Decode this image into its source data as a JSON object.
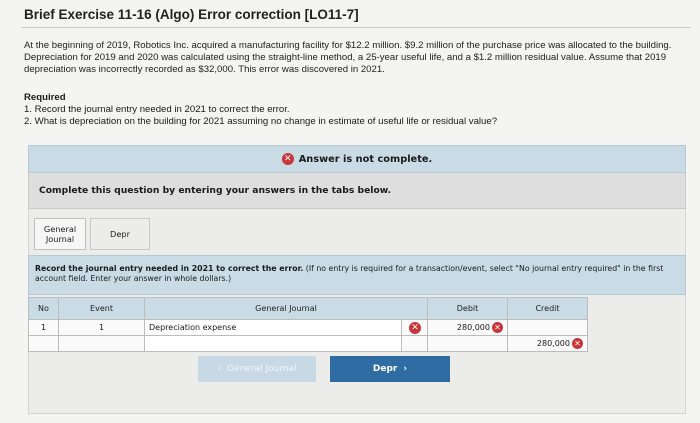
{
  "page": {
    "title": "Brief Exercise 11-16 (Algo) Error correction [LO11-7]",
    "problem": "At the beginning of 2019, Robotics Inc. acquired a manufacturing facility for $12.2 million. $9.2 million of the purchase price was allocated to the building. Depreciation for 2019 and 2020 was calculated using the straight-line method, a 25-year useful life, and a $1.2 million residual value. Assume that 2019 depreciation was incorrectly recorded as $32,000. This error was discovered in 2021.",
    "required_heading": "Required",
    "required_items": [
      "1. Record the journal entry needed in 2021 to correct the error.",
      "2. What is depreciation on the building for 2021 assuming no change in estimate of useful life or residual value?"
    ]
  },
  "status": {
    "icon": "x-circle-icon",
    "text": "Answer is not complete.",
    "color": "#c8353a"
  },
  "complete_prompt": "Complete this question by entering your answers in the tabs below.",
  "tabs": [
    {
      "label_line1": "General",
      "label_line2": "Journal"
    },
    {
      "label_line1": "Depr",
      "label_line2": ""
    }
  ],
  "instructions": {
    "bold": "Record the journal entry needed in 2021 to correct the error.",
    "normal": " (If no entry is required for a transaction/event, select \"No journal entry required\" in the first account field. Enter your answer in whole dollars.)"
  },
  "journal": {
    "headers": {
      "no": "No",
      "event": "Event",
      "general_journal": "General Journal",
      "debit": "Debit",
      "credit": "Credit"
    },
    "rows": [
      {
        "no": "1",
        "event": "1",
        "account": "Depreciation expense",
        "debit": "280,000",
        "credit": "",
        "account_wrong": true,
        "debit_wrong": true
      },
      {
        "no": "",
        "event": "",
        "account": "",
        "debit": "",
        "credit": "280,000",
        "credit_wrong": true
      }
    ]
  },
  "nav": {
    "prev_label": "General Journal",
    "next_label": "Depr",
    "accent": "#2f6ca3"
  }
}
